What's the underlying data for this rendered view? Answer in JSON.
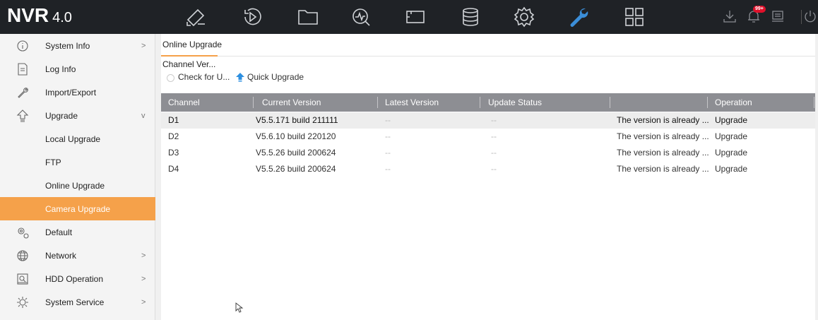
{
  "app": {
    "logo_main": "NVR",
    "logo_version": "4.0"
  },
  "topbar": {
    "nav_icons": [
      "live-view-icon",
      "playback-icon",
      "file-icon",
      "smart-analysis-icon",
      "camera-icon",
      "storage-icon",
      "settings-icon",
      "maintenance-icon",
      "layout-icon"
    ],
    "active_icon": "maintenance-icon",
    "right_icons": [
      "download-icon",
      "alarm-icon",
      "device-icon",
      "power-icon"
    ],
    "alarm_badge": "99+",
    "accent_color": "#3b8ed8"
  },
  "sidebar": {
    "items": [
      {
        "label": "System Info",
        "arrow": ">"
      },
      {
        "label": "Log Info",
        "arrow": ""
      },
      {
        "label": "Import/Export",
        "arrow": ""
      },
      {
        "label": "Upgrade",
        "arrow": "v"
      },
      {
        "label": "Local Upgrade",
        "arrow": ""
      },
      {
        "label": "FTP",
        "arrow": ""
      },
      {
        "label": "Online Upgrade",
        "arrow": ""
      },
      {
        "label": "Camera Upgrade",
        "arrow": ""
      },
      {
        "label": "Default",
        "arrow": ""
      },
      {
        "label": "Network",
        "arrow": ">"
      },
      {
        "label": "HDD Operation",
        "arrow": ">"
      },
      {
        "label": "System Service",
        "arrow": ">"
      }
    ],
    "active_item": "Camera Upgrade",
    "active_color": "#f5a14a"
  },
  "main": {
    "tab_label": "Online Upgrade",
    "section_title": "Channel Ver...",
    "check_label": "Check for U...",
    "quick_upgrade_label": "Quick Upgrade",
    "table": {
      "headers": [
        "Channel",
        "Current Version",
        "Latest Version",
        "Update Status",
        "",
        "Operation"
      ],
      "rows": [
        [
          "D1",
          "V5.5.171 build 211111",
          "--",
          "--",
          "The version is already ...",
          "Upgrade"
        ],
        [
          "D2",
          "V5.6.10 build 220120",
          "--",
          "--",
          "The version is already ...",
          "Upgrade"
        ],
        [
          "D3",
          "V5.5.26 build 200624",
          "--",
          "--",
          "The version is already ...",
          "Upgrade"
        ],
        [
          "D4",
          "V5.5.26 build 200624",
          "--",
          "--",
          "The version is already ...",
          "Upgrade"
        ]
      ]
    }
  }
}
